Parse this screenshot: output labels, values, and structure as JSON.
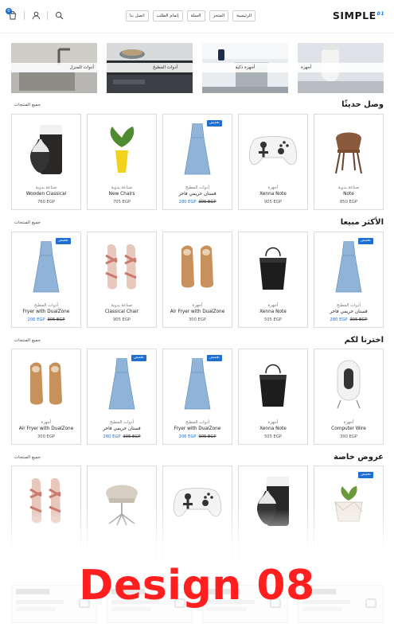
{
  "header": {
    "logo": "SIMPLE",
    "logo_sup": "01",
    "cart_count": "0",
    "nav": [
      "الرئيسية",
      "المتجر",
      "السلة",
      "إتمام الطلب",
      "اتصل بنا"
    ]
  },
  "banners": [
    {
      "label": "أجهزة"
    },
    {
      "label": "أجهزة ذكية"
    },
    {
      "label": "أدوات المطبخ"
    },
    {
      "label": "أدوات للمنزل"
    }
  ],
  "sections": [
    {
      "title": "وصل حديثًا",
      "link": "جميع المنتجات",
      "products": [
        {
          "category": "صناعة يدوية",
          "name": "Note",
          "price": "850 EGP",
          "old_price": "",
          "badge": ""
        },
        {
          "category": "أجهزة",
          "name": "Xenna Note",
          "price": "905 EGP",
          "old_price": "",
          "badge": ""
        },
        {
          "category": "أدوات المطبخ",
          "name": "فستان حريمي فاخر",
          "price": "280 EGP",
          "old_price": "305 EGP",
          "badge": "تخفيض"
        },
        {
          "category": "صناعة يدوية",
          "name": "New Chairs",
          "price": "705 EGP",
          "old_price": "",
          "badge": ""
        },
        {
          "category": "صناعة يدوية",
          "name": "Wooden Classical",
          "price": "760 EGP",
          "old_price": "",
          "badge": ""
        }
      ]
    },
    {
      "title": "الأكثر مبيعا",
      "link": "جميع المنتجات",
      "products": [
        {
          "category": "أدوات المطبخ",
          "name": "فستان حريمي فاخر",
          "price": "280 EGP",
          "old_price": "305 EGP",
          "badge": "تخفيض"
        },
        {
          "category": "أجهزة",
          "name": "Xenna Note",
          "price": "505 EGP",
          "old_price": "",
          "badge": ""
        },
        {
          "category": "أجهزة",
          "name": "Air Fryer with DualZone",
          "price": "300 EGP",
          "old_price": "",
          "badge": ""
        },
        {
          "category": "صناعة يدوية",
          "name": "Classical Chair",
          "price": "905 EGP",
          "old_price": "",
          "badge": ""
        },
        {
          "category": "أدوات المطبخ",
          "name": "Fryer with DualZone",
          "price": "206 EGP",
          "old_price": "305 EGP",
          "badge": "تخفيض"
        }
      ]
    },
    {
      "title": "اخترنا لكم",
      "link": "جميع المنتجات",
      "products": [
        {
          "category": "أجهزة",
          "name": "Computer Wire",
          "price": "390 EGP",
          "old_price": "",
          "badge": ""
        },
        {
          "category": "أجهزة",
          "name": "Xenna Note",
          "price": "505 EGP",
          "old_price": "",
          "badge": ""
        },
        {
          "category": "أدوات المطبخ",
          "name": "Fryer with DualZone",
          "price": "206 EGP",
          "old_price": "305 EGP",
          "badge": "تخفيض"
        },
        {
          "category": "أدوات المطبخ",
          "name": "فستان حريمي فاخر",
          "price": "280 EGP",
          "old_price": "305 EGP",
          "badge": "تخفيض"
        },
        {
          "category": "أجهزة",
          "name": "Air Fryer with DualZone",
          "price": "300 EGP",
          "old_price": "",
          "badge": ""
        }
      ]
    },
    {
      "title": "عروض خاصة",
      "link": "جميع المنتجات",
      "products": [
        {
          "category": "",
          "name": "",
          "price": "",
          "old_price": "",
          "badge": "تخفيض"
        },
        {
          "category": "",
          "name": "",
          "price": "",
          "old_price": "",
          "badge": ""
        },
        {
          "category": "",
          "name": "",
          "price": "",
          "old_price": "",
          "badge": ""
        },
        {
          "category": "",
          "name": "",
          "price": "",
          "old_price": "",
          "badge": ""
        },
        {
          "category": "",
          "name": "",
          "price": "",
          "old_price": "",
          "badge": ""
        }
      ]
    }
  ],
  "overlay_text": "Design 08",
  "colors": {
    "accent": "#1f6fd1",
    "overlay": "#ff1f1f"
  }
}
